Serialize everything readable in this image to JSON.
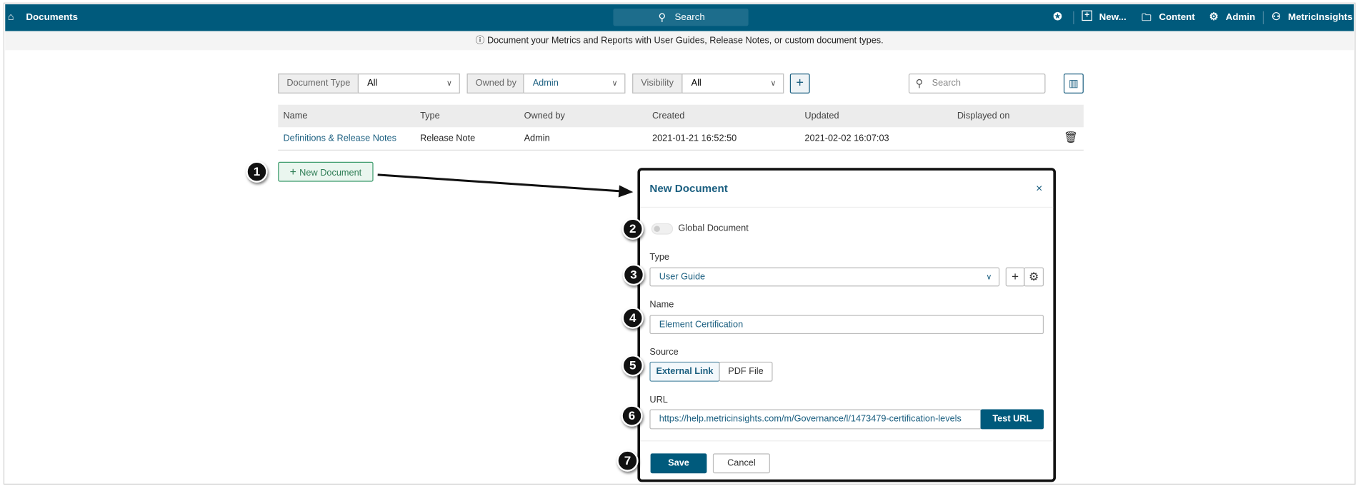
{
  "topbar": {
    "title": "Documents",
    "search": "Search",
    "new": "New...",
    "content": "Content",
    "admin": "Admin",
    "user": "MetricInsights"
  },
  "info": "Document your Metrics and Reports with User Guides, Release Notes, or custom document types.",
  "filters": {
    "document_type_label": "Document Type",
    "document_type_value": "All",
    "owned_by_label": "Owned by",
    "owned_by_value": "Admin",
    "visibility_label": "Visibility",
    "visibility_value": "All",
    "search_placeholder": "Search"
  },
  "table": {
    "headers": [
      "Name",
      "Type",
      "Owned by",
      "Created",
      "Updated",
      "Displayed on"
    ],
    "rows": [
      {
        "name": "Definitions & Release Notes",
        "type": "Release Note",
        "owner": "Admin",
        "created": "2021-01-21 16:52:50",
        "updated": "2021-02-02 16:07:03",
        "displayed_on": ""
      }
    ]
  },
  "new_document_button": "New Document",
  "modal": {
    "title": "New Document",
    "global_label": "Global Document",
    "global_on": false,
    "type_label": "Type",
    "type_value": "User Guide",
    "name_label": "Name",
    "name_value": "Element Certification",
    "source_label": "Source",
    "source_options": [
      "External Link",
      "PDF File"
    ],
    "source_selected": "External Link",
    "url_label": "URL",
    "url_value": "https://help.metricinsights.com/m/Governance/l/1473479-certification-levels",
    "test_url": "Test URL",
    "save": "Save",
    "cancel": "Cancel"
  },
  "callouts": [
    "1",
    "2",
    "3",
    "4",
    "5",
    "6",
    "7"
  ],
  "colors": {
    "brand": "#005a7c",
    "accent_green": "#2e8b57"
  }
}
